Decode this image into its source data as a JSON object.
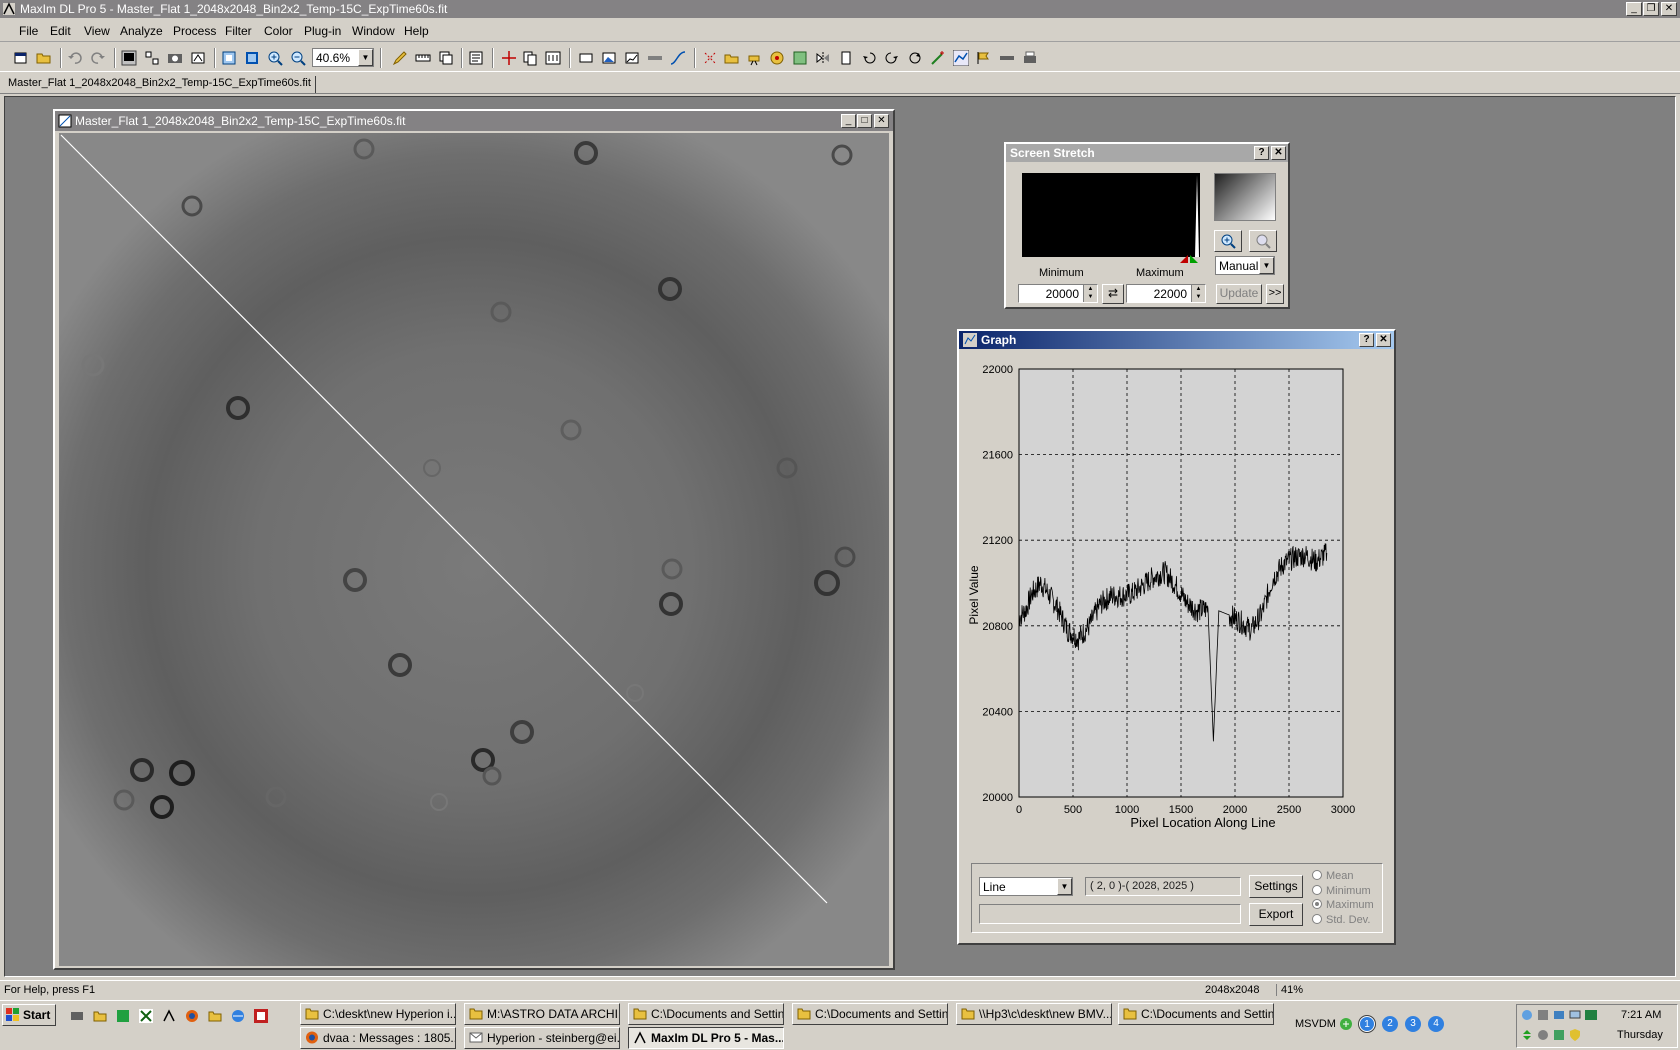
{
  "window": {
    "title": "MaxIm DL Pro 5 - Master_Flat 1_2048x2048_Bin2x2_Temp-15C_ExpTime60s.fit",
    "icon": "maxim-app-icon"
  },
  "menu": [
    "File",
    "Edit",
    "View",
    "Analyze",
    "Process",
    "Filter",
    "Color",
    "Plug-in",
    "Window",
    "Help"
  ],
  "toolbar": {
    "zoom_value": "40.6%"
  },
  "doc_tab": "Master_Flat 1_2048x2048_Bin2x2_Temp-15C_ExpTime60s.fit",
  "image_window": {
    "title": "Master_Flat 1_2048x2048_Bin2x2_Temp-15C_ExpTime60s.fit",
    "line": {
      "from": [
        2,
        0
      ],
      "to": [
        2028,
        2025
      ]
    }
  },
  "screen_stretch": {
    "title": "Screen Stretch",
    "min_label": "Minimum",
    "max_label": "Maximum",
    "min_value": "20000",
    "max_value": "22000",
    "mode": "Manual",
    "update_label": "Update",
    "more_label": ">>"
  },
  "graph": {
    "title": "Graph",
    "mode": "Line",
    "coords": "( 2, 0 )-( 2028, 2025 )",
    "settings_label": "Settings",
    "export_label": "Export",
    "stat_text": "",
    "radio": [
      {
        "label": "Mean",
        "checked": false
      },
      {
        "label": "Minimum",
        "checked": false
      },
      {
        "label": "Maximum",
        "checked": true
      },
      {
        "label": "Std. Dev.",
        "checked": false
      }
    ]
  },
  "chart_data": {
    "type": "line",
    "title": "",
    "xlabel": "Pixel Location Along Line",
    "ylabel": "Pixel Value",
    "xlim": [
      0,
      3000
    ],
    "ylim": [
      20000,
      22000
    ],
    "xticks": [
      0,
      500,
      1000,
      1500,
      2000,
      2500,
      3000
    ],
    "yticks": [
      20000,
      20400,
      20800,
      21200,
      21600,
      22000
    ],
    "grid": true,
    "series": [
      {
        "x": [
          0,
          60,
          120,
          200,
          260,
          350,
          450,
          550,
          650,
          750,
          850,
          950,
          1050,
          1150,
          1250,
          1350,
          1450,
          1550,
          1650,
          1750,
          1800,
          1850,
          1950,
          2050,
          2150,
          2250,
          2350,
          2450,
          2550,
          2650,
          2750,
          2850
        ],
        "y": [
          20840,
          20870,
          20950,
          21000,
          20960,
          20890,
          20780,
          20740,
          20800,
          20900,
          20940,
          20940,
          20950,
          20990,
          21030,
          21050,
          20990,
          20910,
          20870,
          20880,
          20260,
          20870,
          20850,
          20820,
          20780,
          20860,
          21020,
          21090,
          21120,
          21130,
          21100,
          21140
        ]
      }
    ]
  },
  "status": {
    "help": "For Help, press F1",
    "size": "2048x2048",
    "zoom": "41%"
  },
  "taskbar": {
    "start": "Start",
    "row1": [
      "C:\\deskt\\new Hyperion i...",
      "M:\\ASTRO DATA ARCHI...",
      "C:\\Documents and Settin...",
      "C:\\Documents and Settin...",
      "\\\\Hp3\\c\\deskt\\new BMV...",
      "C:\\Documents and Settin..."
    ],
    "row2": [
      "dvaa : Messages : 1805...",
      "Hyperion - steinberg@ei...",
      "MaxIm DL Pro 5 - Mas..."
    ],
    "msvdm": "MSVDM",
    "workspaces": [
      "1",
      "2",
      "3",
      "4"
    ],
    "clock": "7:21 AM",
    "day": "Thursday"
  }
}
